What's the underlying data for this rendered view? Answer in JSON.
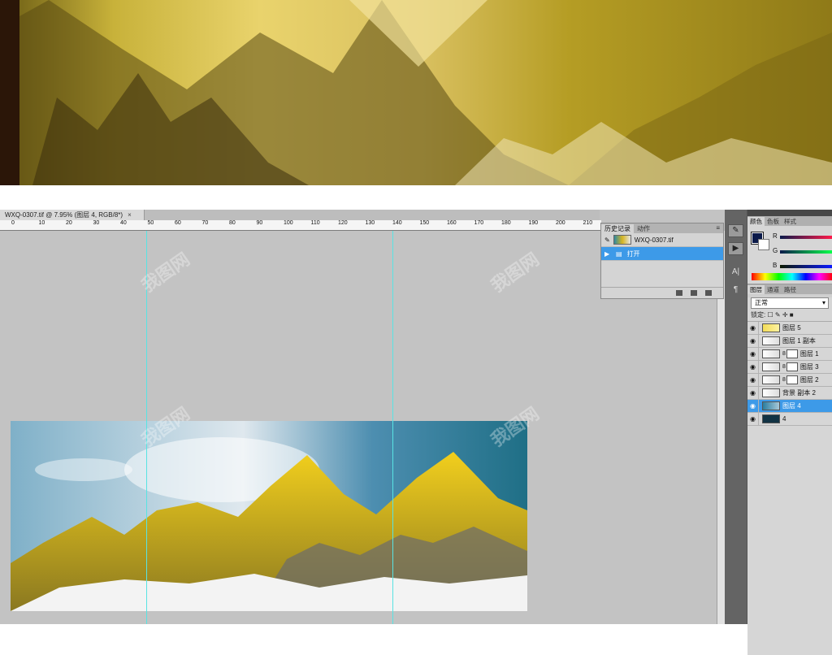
{
  "doc_tab": {
    "title": "WXQ-0307.tif @ 7.95% (图层 4, RGB/8*)",
    "close": "×"
  },
  "ruler": {
    "labels": [
      "0",
      "10",
      "20",
      "30",
      "40",
      "50",
      "60",
      "70",
      "80",
      "90",
      "100",
      "110",
      "120",
      "130",
      "140",
      "150",
      "160",
      "170",
      "180",
      "190",
      "200",
      "210"
    ]
  },
  "history_panel": {
    "tabs": [
      "历史记录",
      "动作"
    ],
    "collapse": "▸▸",
    "menu": "≡",
    "snapshot_name": "WXQ-0307.tif",
    "steps": [
      {
        "label": "打开",
        "selected": true
      }
    ]
  },
  "tools": {
    "brush": "✎",
    "play": "▶",
    "text": "A|",
    "para": "¶"
  },
  "color_panel": {
    "tabs": [
      "颜色",
      "色板",
      "样式"
    ],
    "channels": [
      "R",
      "G",
      "B"
    ],
    "fg": "#0b1a4a",
    "bg": "#ffffff"
  },
  "layers_panel": {
    "tabs": [
      "图层",
      "通道",
      "路径"
    ],
    "blend_mode": "正常",
    "lock_label": "锁定:",
    "layers": [
      {
        "name": "图层 5",
        "thumb": "yellow",
        "mask": false,
        "selected": false
      },
      {
        "name": "图层 1 副本",
        "thumb": "plain",
        "mask": false,
        "selected": false
      },
      {
        "name": "图层 1",
        "thumb": "plain",
        "mask": true,
        "selected": false
      },
      {
        "name": "图层 3",
        "thumb": "plain",
        "mask": true,
        "selected": false
      },
      {
        "name": "图层 2",
        "thumb": "plain",
        "mask": true,
        "selected": false
      },
      {
        "name": "背景 副本 2",
        "thumb": "plain",
        "mask": false,
        "selected": false
      },
      {
        "name": "图层 4",
        "thumb": "blue",
        "mask": false,
        "selected": true
      },
      {
        "name": "4",
        "thumb": "dark",
        "mask": false,
        "selected": false
      }
    ]
  },
  "colors": {
    "accent": "#3d9ae8",
    "guide": "#59e3e3",
    "workspace": "#c3c3c3"
  },
  "watermark": "我图网"
}
